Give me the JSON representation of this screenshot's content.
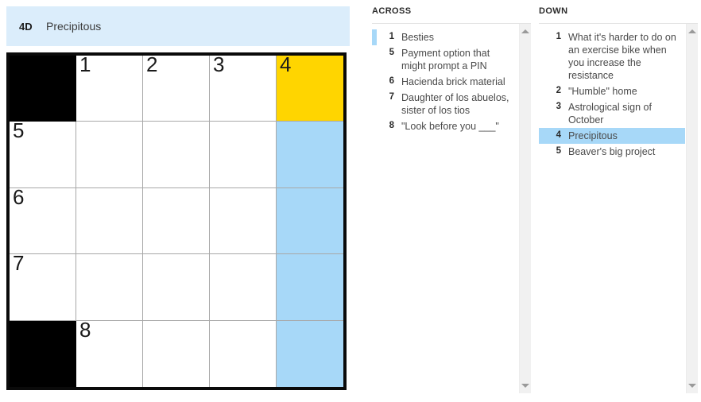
{
  "current_clue": {
    "number": "4D",
    "text": "Precipitous"
  },
  "colors": {
    "banner_bg": "#dbedfb",
    "cursor_cell": "#ffd500",
    "highlight_cell": "#a7d8f8",
    "block_cell": "#000000",
    "selected_clue": "#a7d8f8"
  },
  "grid": {
    "rows": 5,
    "cols": 5,
    "cells": [
      [
        {
          "type": "block",
          "number": "",
          "letter": "",
          "state": "normal"
        },
        {
          "type": "open",
          "number": "1",
          "letter": "",
          "state": "normal"
        },
        {
          "type": "open",
          "number": "2",
          "letter": "",
          "state": "normal"
        },
        {
          "type": "open",
          "number": "3",
          "letter": "",
          "state": "normal"
        },
        {
          "type": "open",
          "number": "4",
          "letter": "",
          "state": "cursor"
        }
      ],
      [
        {
          "type": "open",
          "number": "5",
          "letter": "",
          "state": "normal"
        },
        {
          "type": "open",
          "number": "",
          "letter": "",
          "state": "normal"
        },
        {
          "type": "open",
          "number": "",
          "letter": "",
          "state": "normal"
        },
        {
          "type": "open",
          "number": "",
          "letter": "",
          "state": "normal"
        },
        {
          "type": "open",
          "number": "",
          "letter": "",
          "state": "highlight"
        }
      ],
      [
        {
          "type": "open",
          "number": "6",
          "letter": "",
          "state": "normal"
        },
        {
          "type": "open",
          "number": "",
          "letter": "",
          "state": "normal"
        },
        {
          "type": "open",
          "number": "",
          "letter": "",
          "state": "normal"
        },
        {
          "type": "open",
          "number": "",
          "letter": "",
          "state": "normal"
        },
        {
          "type": "open",
          "number": "",
          "letter": "",
          "state": "highlight"
        }
      ],
      [
        {
          "type": "open",
          "number": "7",
          "letter": "",
          "state": "normal"
        },
        {
          "type": "open",
          "number": "",
          "letter": "",
          "state": "normal"
        },
        {
          "type": "open",
          "number": "",
          "letter": "",
          "state": "normal"
        },
        {
          "type": "open",
          "number": "",
          "letter": "",
          "state": "normal"
        },
        {
          "type": "open",
          "number": "",
          "letter": "",
          "state": "highlight"
        }
      ],
      [
        {
          "type": "block",
          "number": "",
          "letter": "",
          "state": "normal"
        },
        {
          "type": "open",
          "number": "8",
          "letter": "",
          "state": "normal"
        },
        {
          "type": "open",
          "number": "",
          "letter": "",
          "state": "normal"
        },
        {
          "type": "open",
          "number": "",
          "letter": "",
          "state": "normal"
        },
        {
          "type": "open",
          "number": "",
          "letter": "",
          "state": "highlight"
        }
      ]
    ]
  },
  "across": {
    "title": "ACROSS",
    "clues": [
      {
        "number": "1",
        "text": "Besties",
        "state": "cursor"
      },
      {
        "number": "5",
        "text": "Payment option that might prompt a PIN",
        "state": "normal"
      },
      {
        "number": "6",
        "text": "Hacienda brick material",
        "state": "normal"
      },
      {
        "number": "7",
        "text": "Daughter of los abuelos, sister of los tios",
        "state": "normal"
      },
      {
        "number": "8",
        "text": "\"Look before you ___\"",
        "state": "normal"
      }
    ]
  },
  "down": {
    "title": "DOWN",
    "clues": [
      {
        "number": "1",
        "text": "What it's harder to do on an exercise bike when you increase the resistance",
        "state": "normal"
      },
      {
        "number": "2",
        "text": "\"Humble\" home",
        "state": "normal"
      },
      {
        "number": "3",
        "text": "Astrological sign of October",
        "state": "normal"
      },
      {
        "number": "4",
        "text": "Precipitous",
        "state": "selected"
      },
      {
        "number": "5",
        "text": "Beaver's big project",
        "state": "normal"
      }
    ]
  },
  "scrollbars": {
    "across": {
      "up_icon": "triangle-up-icon",
      "down_icon": "triangle-down-icon"
    },
    "down": {
      "up_icon": "triangle-up-icon",
      "down_icon": "triangle-down-icon"
    }
  }
}
